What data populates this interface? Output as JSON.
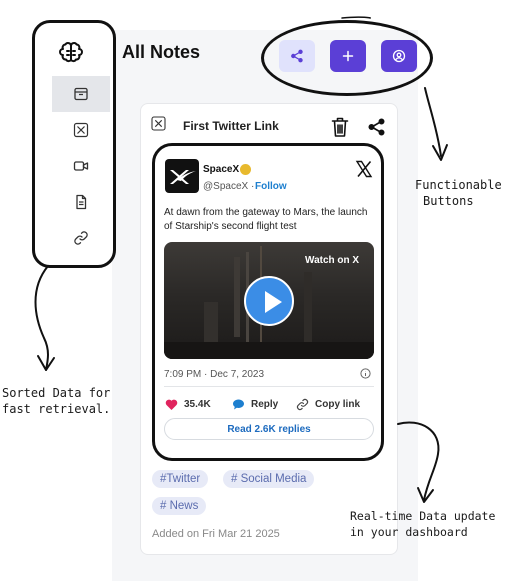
{
  "app": {
    "page_title": "All Notes"
  },
  "sidebar": {
    "items": [
      {
        "icon": "brain-icon"
      },
      {
        "icon": "inbox-icon",
        "active": true
      },
      {
        "icon": "x-logo-icon"
      },
      {
        "icon": "video-icon"
      },
      {
        "icon": "document-icon"
      },
      {
        "icon": "link-icon"
      }
    ]
  },
  "toolbar": {
    "buttons": [
      {
        "icon": "share-icon",
        "style": "light"
      },
      {
        "icon": "plus-icon",
        "label": "+",
        "style": "dark"
      },
      {
        "icon": "user-circle-icon",
        "style": "dark"
      }
    ]
  },
  "note": {
    "type_icon": "x-logo-icon",
    "title": "First Twitter Link",
    "tweet": {
      "name": "SpaceX",
      "handle": "@SpaceX",
      "separator": "·",
      "follow": "Follow",
      "text": "At dawn from the gateway to Mars, the launch of Starship's second flight test",
      "media_label": "Watch on X",
      "date": "7:09 PM · Dec 7, 2023",
      "likes": "35.4K",
      "reply": "Reply",
      "copy_link": "Copy link",
      "read_replies": "Read 2.6K replies"
    },
    "tags": [
      "#Twitter",
      "# Social Media",
      "# News"
    ],
    "added": "Added on Fri Mar 21 2025"
  },
  "annotations": {
    "buttons": [
      "Functionable",
      "Buttons"
    ],
    "sidebar": [
      "Sorted Data for",
      "fast retrieval."
    ],
    "realtime": [
      "Real-time Data update",
      "in your dashboard"
    ]
  },
  "colors": {
    "accent": "#5b3fd6",
    "accent_light": "#e0e2fc",
    "like": "#e0245e",
    "link": "#1d7fcf",
    "tag_bg": "#e7eaf7",
    "tag_text": "#5b6cae"
  }
}
